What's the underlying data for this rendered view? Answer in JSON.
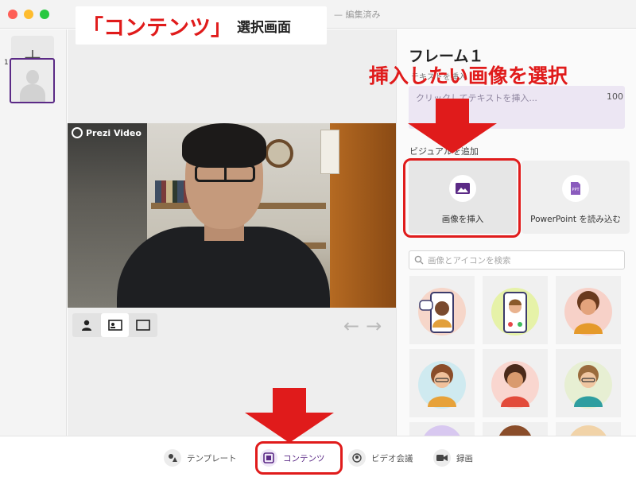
{
  "window": {
    "title": "— 編集済み"
  },
  "sidebar": {
    "add_label": "+",
    "frames": [
      {
        "number": "1"
      }
    ]
  },
  "video": {
    "badge": "Prezi Video"
  },
  "panel": {
    "frame_title": "フレーム１",
    "text_label": "テキストを挿入",
    "text_placeholder": "クリックしてテキストを挿入...",
    "text_count": "100",
    "visual_label": "ビジュアルを追加",
    "insert_image_label": "画像を挿入",
    "powerpoint_label": "PowerPoint を読み込む",
    "search_placeholder": "画像とアイコンを検索"
  },
  "bottombar": {
    "tabs": [
      {
        "label": "テンプレート",
        "icon": "shapes-icon"
      },
      {
        "label": "コンテンツ",
        "icon": "content-icon",
        "active": true
      },
      {
        "label": "ビデオ会議",
        "icon": "video-call-icon"
      },
      {
        "label": "録画",
        "icon": "camera-icon"
      }
    ]
  },
  "annotations": {
    "title_main": "「コンテンツ」",
    "title_sub": "選択画面",
    "right_note": "挿入したい画像を選択"
  },
  "colors": {
    "accent": "#5b2a86",
    "annotation": "#e01b1b"
  }
}
